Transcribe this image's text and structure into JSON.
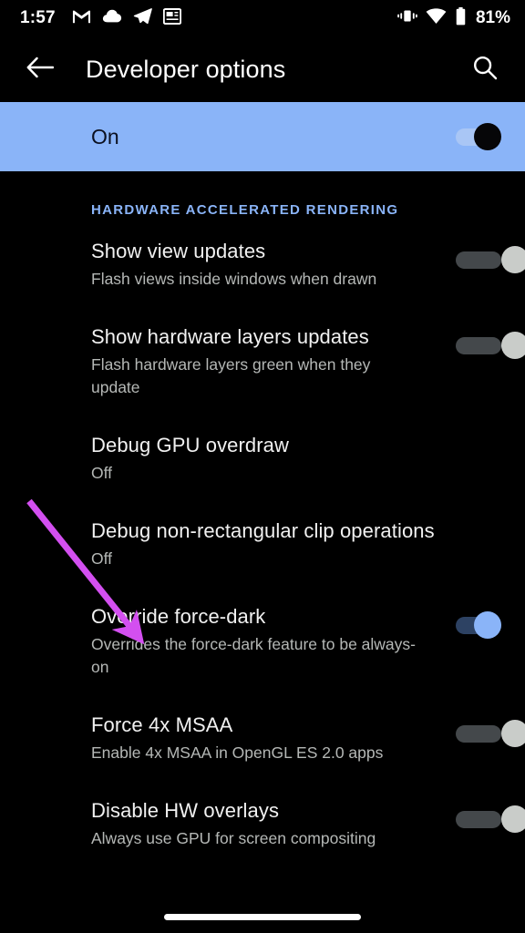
{
  "status_bar": {
    "time": "1:57",
    "left_icons": [
      "gmail-icon",
      "cloud-icon",
      "telegram-icon",
      "news-icon"
    ],
    "right_icons": [
      "vibrate-icon",
      "wifi-icon",
      "battery-icon"
    ],
    "battery_label": "81%"
  },
  "app_bar": {
    "back_icon": "arrow-left-icon",
    "title": "Developer options",
    "search_icon": "search-icon"
  },
  "master_switch": {
    "label": "On",
    "state": "on",
    "background_color": "#8ab4f8"
  },
  "section": {
    "header": "HARDWARE ACCELERATED RENDERING",
    "header_color": "#8ab4f8"
  },
  "rows": [
    {
      "title": "Show view updates",
      "subtitle": "Flash views inside windows when drawn",
      "control": "switch",
      "state": "off"
    },
    {
      "title": "Show hardware layers updates",
      "subtitle": "Flash hardware layers green when they update",
      "control": "switch",
      "state": "off"
    },
    {
      "title": "Debug GPU overdraw",
      "subtitle": "Off",
      "control": "none",
      "state": ""
    },
    {
      "title": "Debug non-rectangular clip operations",
      "subtitle": "Off",
      "control": "none",
      "state": ""
    },
    {
      "title": "Override force-dark",
      "subtitle": "Overrides the force-dark feature to be always-on",
      "control": "switch",
      "state": "on"
    },
    {
      "title": "Force 4x MSAA",
      "subtitle": "Enable 4x MSAA in OpenGL ES 2.0 apps",
      "control": "switch",
      "state": "off"
    },
    {
      "title": "Disable HW overlays",
      "subtitle": "Always use GPU for screen compositing",
      "control": "switch",
      "state": "off"
    }
  ],
  "annotation": {
    "type": "arrow",
    "color": "#d34ff0",
    "points_to": "Override force-dark"
  },
  "navigation": {
    "gesture_pill": "home-gesture-bar"
  },
  "theme": {
    "background": "#000000",
    "accent": "#8ab4f8",
    "title_text": "#f1f1f1",
    "subtitle_text": "#b5b8b6"
  }
}
